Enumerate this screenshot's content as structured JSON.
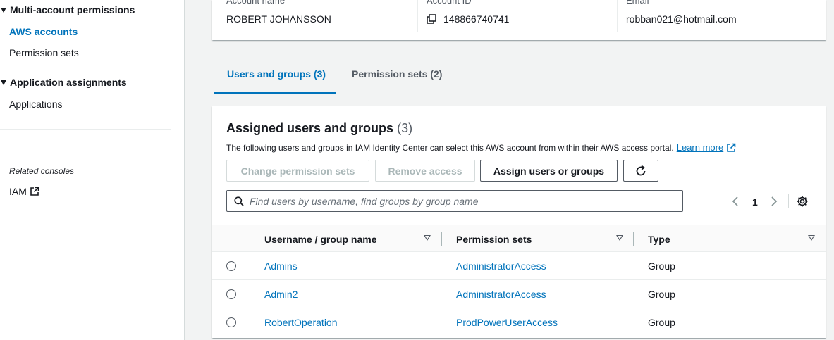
{
  "sidebar": {
    "multi_account_heading": "Multi-account permissions",
    "aws_accounts": "AWS accounts",
    "permission_sets": "Permission sets",
    "app_assign_heading": "Application assignments",
    "applications": "Applications",
    "related_consoles": "Related consoles",
    "iam": "IAM"
  },
  "account": {
    "name_label": "Account name",
    "name_value": "ROBERT JOHANSSON",
    "id_label": "Account ID",
    "id_value": "148866740741",
    "email_label": "Email",
    "email_value": "robban021@hotmail.com"
  },
  "tabs": [
    {
      "label": "Users and groups (3)",
      "active": true
    },
    {
      "label": "Permission sets (2)",
      "active": false
    }
  ],
  "panel": {
    "title": "Assigned users and groups",
    "count": "(3)",
    "description": "The following users and groups in IAM Identity Center can select this AWS account from within their AWS access portal.",
    "learn_more": "Learn more",
    "buttons": {
      "change_permission_sets": "Change permission sets",
      "remove_access": "Remove access",
      "assign_users_or_groups": "Assign users or groups"
    },
    "search_placeholder": "Find users by username, find groups by group name",
    "page_number": "1"
  },
  "table": {
    "columns": [
      "Username / group name",
      "Permission sets",
      "Type"
    ],
    "rows": [
      {
        "name": "Admins",
        "permission_set": "AdministratorAccess",
        "type": "Group"
      },
      {
        "name": "Admin2",
        "permission_set": "AdministratorAccess",
        "type": "Group"
      },
      {
        "name": "RobertOperation",
        "permission_set": "ProdPowerUserAccess",
        "type": "Group"
      }
    ]
  },
  "colors": {
    "link": "#0073bb",
    "text": "#16191f",
    "background": "#f2f3f3"
  },
  "icons": [
    "copy-icon",
    "external-link-icon",
    "refresh-icon",
    "search-icon",
    "chevron-left-icon",
    "chevron-right-icon",
    "settings-gear-icon",
    "caret-down-icon",
    "sort-caret-icon"
  ]
}
